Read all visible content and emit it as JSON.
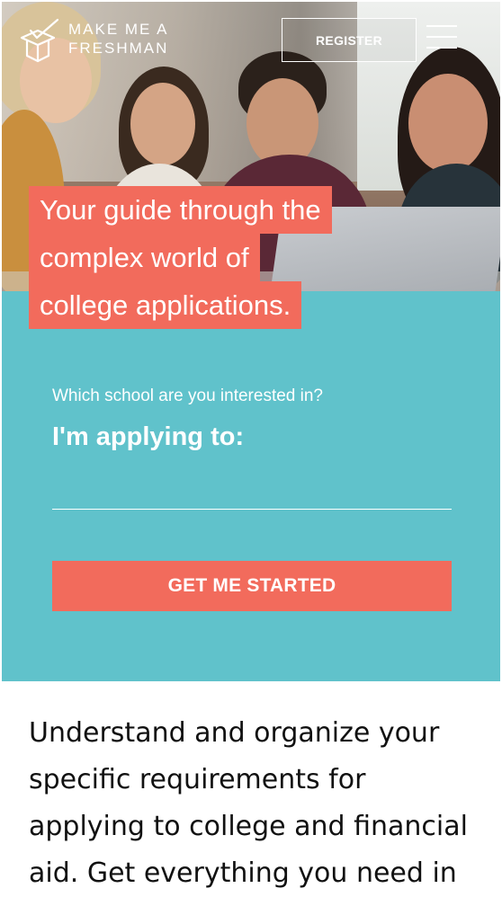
{
  "header": {
    "logo_line1": "MAKE ME A",
    "logo_line2": "FRESHMAN",
    "register_label": "REGISTER"
  },
  "hero": {
    "headline_lines": [
      "Your guide through the",
      "complex world of",
      "college applications."
    ]
  },
  "search": {
    "question": "Which school are you interested in?",
    "label": "I'm applying to:",
    "input_value": "",
    "cta_label": "GET ME STARTED"
  },
  "intro": {
    "lines": [
      "Understand and organize your",
      "specific requirements for",
      "applying to college and financial",
      "aid. Get everything you need in"
    ]
  },
  "colors": {
    "teal": "#60c2cb",
    "coral": "#f26b5c",
    "white": "#ffffff"
  }
}
